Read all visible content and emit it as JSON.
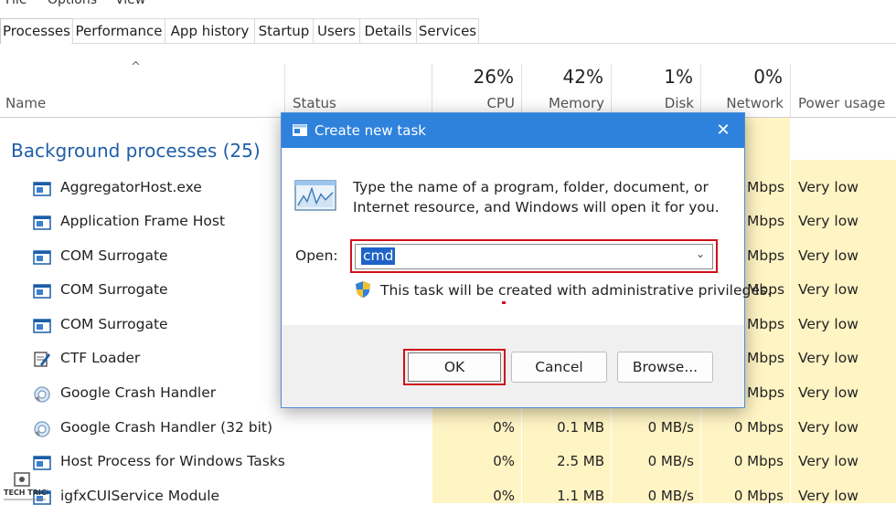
{
  "menu": [
    "File",
    "Options",
    "View"
  ],
  "tabs": [
    "Processes",
    "Performance",
    "App history",
    "Startup",
    "Users",
    "Details",
    "Services"
  ],
  "header": {
    "name": "Name",
    "status": "Status",
    "cpu_pct": "26%",
    "cpu": "CPU",
    "memory_pct": "42%",
    "memory": "Memory",
    "disk_pct": "1%",
    "disk": "Disk",
    "network_pct": "0%",
    "network": "Network",
    "power": "Power usage"
  },
  "section_title": "Background processes (25)",
  "rows": [
    {
      "name": "AggregatorHost.exe",
      "icon": "window-app-icon",
      "network": "Mbps",
      "power": "Very low"
    },
    {
      "name": "Application Frame Host",
      "icon": "window-app-icon",
      "network": "Mbps",
      "power": "Very low"
    },
    {
      "name": "COM Surrogate",
      "icon": "window-app-icon",
      "network": "Mbps",
      "power": "Very low"
    },
    {
      "name": "COM Surrogate",
      "icon": "window-app-icon",
      "network": "Mbps",
      "power": "Very low"
    },
    {
      "name": "COM Surrogate",
      "icon": "window-app-icon",
      "network": "Mbps",
      "power": "Very low"
    },
    {
      "name": "CTF Loader",
      "icon": "pen-notepad-icon",
      "network": "Mbps",
      "power": "Very low"
    },
    {
      "name": "Google Crash Handler",
      "icon": "google-crash-icon",
      "network": "Mbps",
      "power": "Very low"
    },
    {
      "name": "Google Crash Handler (32 bit)",
      "icon": "google-crash-icon",
      "cpu": "0%",
      "memory": "0.1 MB",
      "disk": "0 MB/s",
      "network": "0 Mbps",
      "power": "Very low"
    },
    {
      "name": "Host Process for Windows Tasks",
      "icon": "window-app-icon",
      "cpu": "0%",
      "memory": "2.5 MB",
      "disk": "0 MB/s",
      "network": "0 Mbps",
      "power": "Very low"
    },
    {
      "name": "igfxCUIService Module",
      "icon": "window-app-icon",
      "cpu": "0%",
      "memory": "1.1 MB",
      "disk": "0 MB/s",
      "network": "0 Mbps",
      "power": "Very low"
    }
  ],
  "dialog": {
    "title": "Create new task",
    "message": "Type the name of a program, folder, document, or Internet resource, and Windows will open it for you.",
    "open_label": "Open:",
    "open_value": "cmd",
    "admin_note": "This task will be created with administrative privileges.",
    "ok": "OK",
    "cancel": "Cancel",
    "browse": "Browse..."
  },
  "colors": {
    "accent": "#2f82dc",
    "highlight_red": "#d0101a",
    "yellow_col": "#fff4c4",
    "section_blue": "#1f5fa6"
  }
}
